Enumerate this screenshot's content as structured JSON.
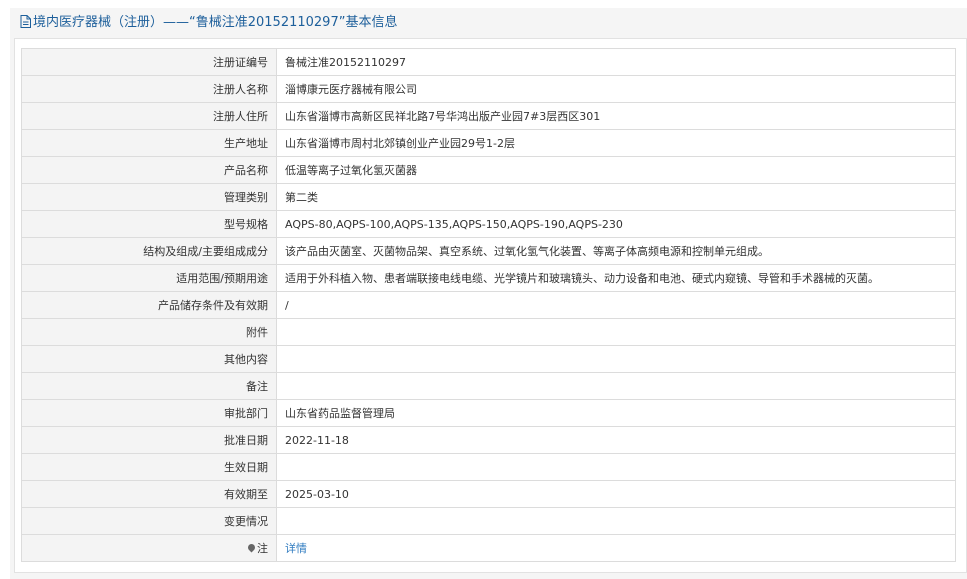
{
  "header": {
    "icon": "document-icon",
    "title": "境内医疗器械（注册）——“鲁械注准20152110297”基本信息"
  },
  "rows": [
    {
      "label": "注册证编号",
      "value": "鲁械注准20152110297"
    },
    {
      "label": "注册人名称",
      "value": "淄博康元医疗器械有限公司"
    },
    {
      "label": "注册人住所",
      "value": "山东省淄博市高新区民祥北路7号华鸿出版产业园7#3层西区301"
    },
    {
      "label": "生产地址",
      "value": "山东省淄博市周村北郊镇创业产业园29号1-2层"
    },
    {
      "label": "产品名称",
      "value": "低温等离子过氧化氢灭菌器"
    },
    {
      "label": "管理类别",
      "value": "第二类"
    },
    {
      "label": "型号规格",
      "value": "AQPS-80,AQPS-100,AQPS-135,AQPS-150,AQPS-190,AQPS-230"
    },
    {
      "label": "结构及组成/主要组成成分",
      "value": "该产品由灭菌室、灭菌物品架、真空系统、过氧化氢气化装置、等离子体高频电源和控制单元组成。"
    },
    {
      "label": "适用范围/预期用途",
      "value": "适用于外科植入物、患者端联接电线电缆、光学镜片和玻璃镜头、动力设备和电池、硬式内窥镜、导管和手术器械的灭菌。"
    },
    {
      "label": "产品储存条件及有效期",
      "value": "/"
    },
    {
      "label": "附件",
      "value": ""
    },
    {
      "label": "其他内容",
      "value": ""
    },
    {
      "label": "备注",
      "value": ""
    },
    {
      "label": "审批部门",
      "value": "山东省药品监督管理局"
    },
    {
      "label": "批准日期",
      "value": "2022-11-18"
    },
    {
      "label": "生效日期",
      "value": ""
    },
    {
      "label": "有效期至",
      "value": "2025-03-10"
    },
    {
      "label": "变更情况",
      "value": ""
    }
  ],
  "note_row": {
    "icon": "pin-icon",
    "label": "注",
    "link_text": "详情"
  },
  "colors": {
    "header_text": "#1d5f9b",
    "link": "#2f7bc0",
    "label_bg": "#f4f4f4",
    "border": "#dcdcdc"
  }
}
